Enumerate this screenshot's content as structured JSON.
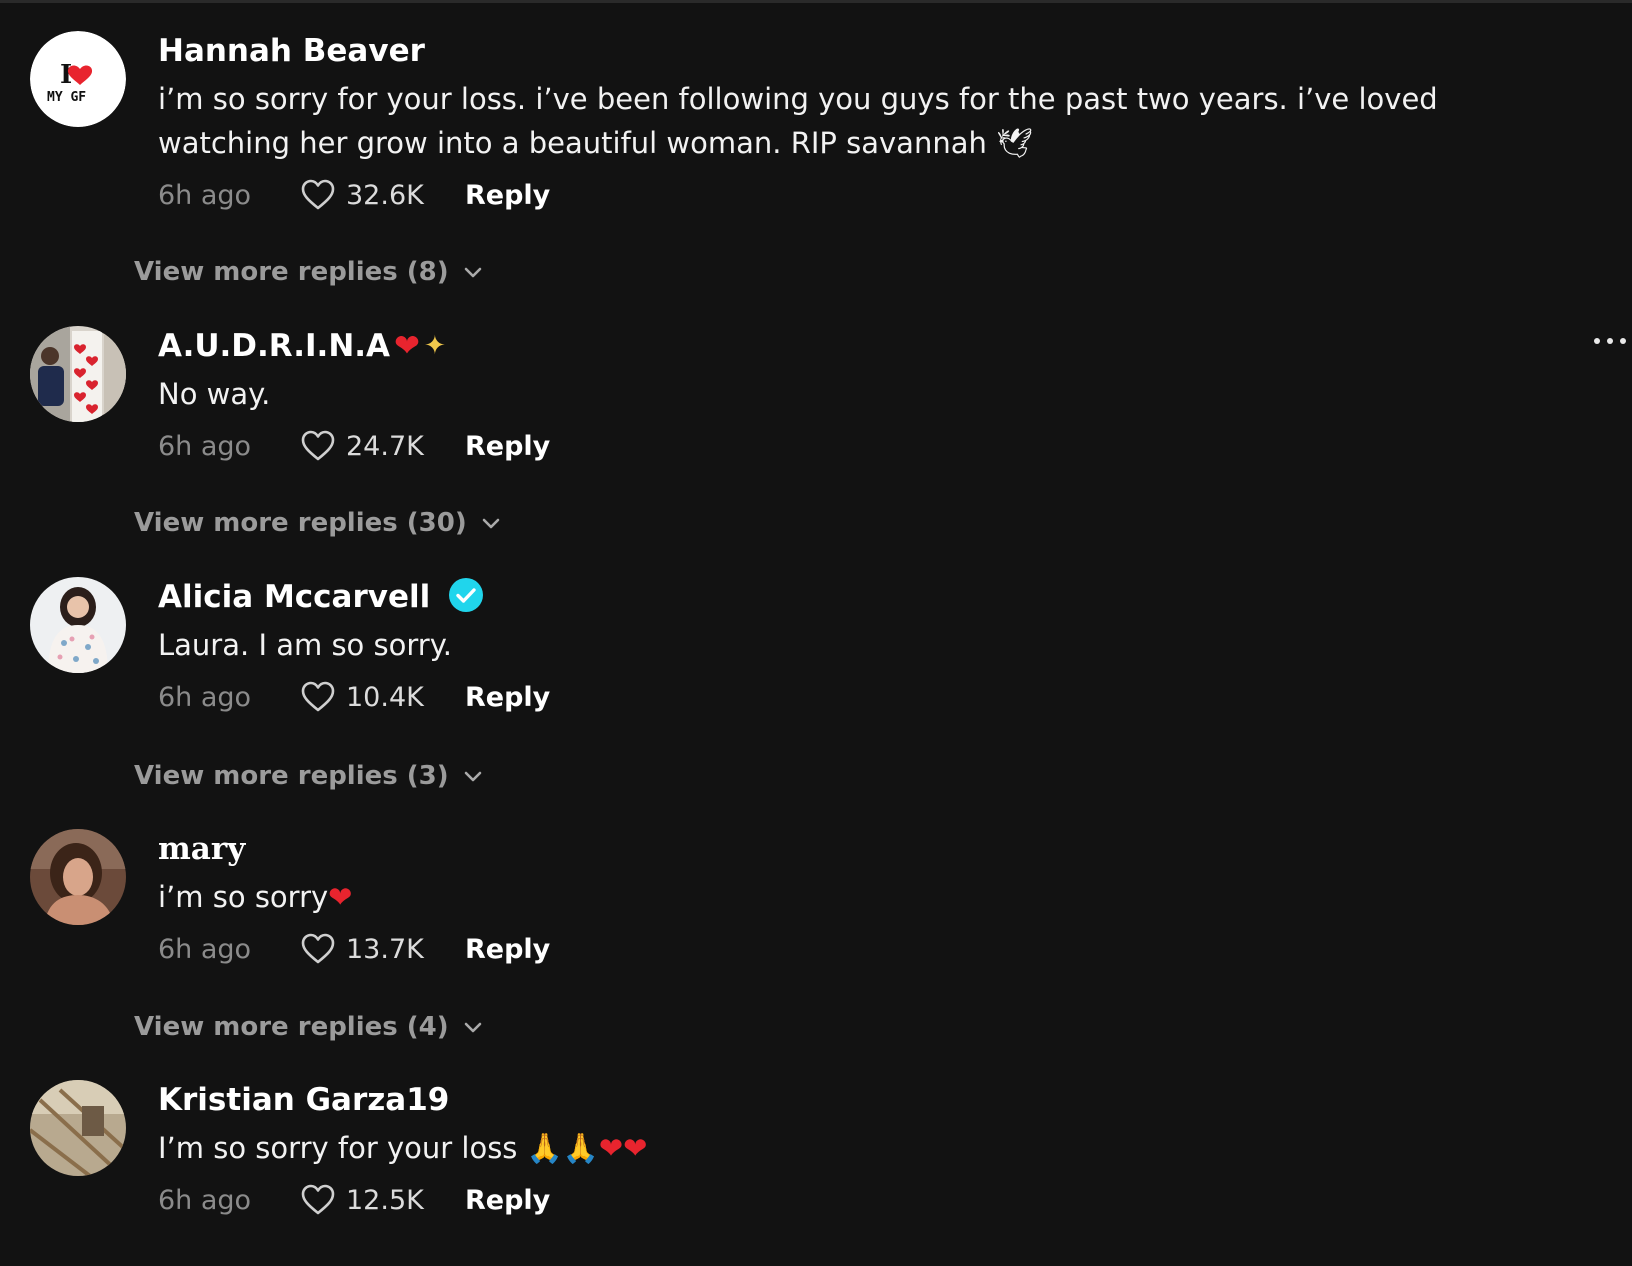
{
  "comments": [
    {
      "username": "Hannah Beaver",
      "username_emoji": "",
      "verified": false,
      "text": "i’m so sorry for your loss. i’ve been following you guys for the past two years. i’ve loved watching her grow into a beautiful woman. RIP savannah 🕊",
      "time": "6h ago",
      "likes": "32.6K",
      "reply_label": "Reply",
      "more_replies": "View more replies (8)",
      "avatar_text_top": "I",
      "avatar_text_bottom": "MY GF"
    },
    {
      "username": "A.U.D.R.I.N.A",
      "username_emoji_1": "❤",
      "username_emoji_2": "✦",
      "verified": false,
      "text": "No way.",
      "time": "6h ago",
      "likes": "24.7K",
      "reply_label": "Reply",
      "more_replies": "View more replies (30)"
    },
    {
      "username": "Alicia Mccarvell",
      "verified": true,
      "text": "Laura. I am so sorry.",
      "time": "6h ago",
      "likes": "10.4K",
      "reply_label": "Reply",
      "more_replies": "View more replies (3)"
    },
    {
      "username": "mary",
      "verified": false,
      "text": "i’m so sorry",
      "text_emoji": "❤",
      "time": "6h ago",
      "likes": "13.7K",
      "reply_label": "Reply",
      "more_replies": "View more replies (4)"
    },
    {
      "username": "Kristian Garza19",
      "verified": false,
      "text": "I’m so sorry for your loss ",
      "text_emoji": "🙏🙏❤❤",
      "time": "6h ago",
      "likes": "12.5K",
      "reply_label": "Reply"
    }
  ],
  "icons": {
    "like": "heart-outline-icon",
    "expand": "chevron-down-icon",
    "verified": "verified-badge-icon",
    "more": "more-options-icon"
  },
  "colors": {
    "background": "#121212",
    "verified_badge": "#20d5ec",
    "heart_emoji": "#e8242e",
    "muted_text": "#8b8b8b"
  }
}
